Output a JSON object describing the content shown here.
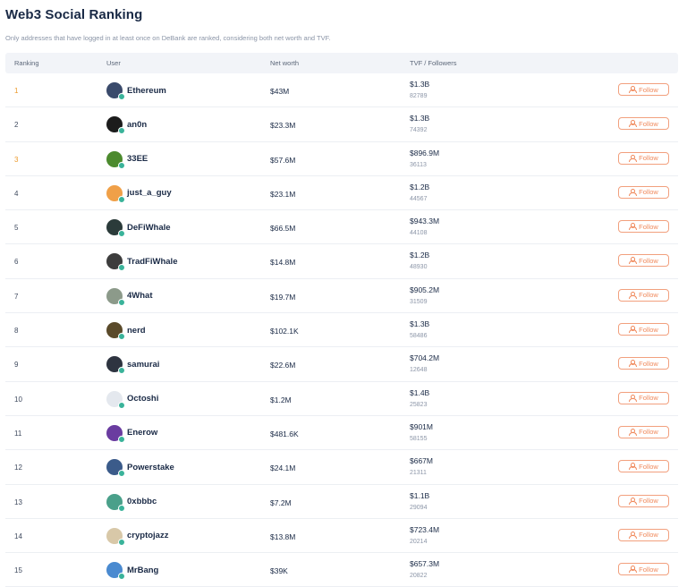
{
  "header": {
    "title": "Web3 Social Ranking",
    "subtitle": "Only addresses that have logged in at least once on DeBank are ranked, considering both net worth and TVF."
  },
  "columns": [
    "Ranking",
    "User",
    "Net worth",
    "TVF / Followers"
  ],
  "follow_label": "Follow",
  "colors": {
    "accent": "#f08a5d",
    "top_rank": "#ec9a2c"
  },
  "rows": [
    {
      "rank": "1",
      "user": "Ethereum",
      "net_worth": "$43M",
      "tvf": "$1.3B",
      "followers": "82789",
      "avatar_color": "#3a4a6b"
    },
    {
      "rank": "2",
      "user": "an0n",
      "net_worth": "$23.3M",
      "tvf": "$1.3B",
      "followers": "74392",
      "avatar_color": "#1c1c1c"
    },
    {
      "rank": "3",
      "user": "33EE",
      "net_worth": "$57.6M",
      "tvf": "$896.9M",
      "followers": "36113",
      "avatar_color": "#4c8a2e"
    },
    {
      "rank": "4",
      "user": "just_a_guy",
      "net_worth": "$23.1M",
      "tvf": "$1.2B",
      "followers": "44567",
      "avatar_color": "#f0a048"
    },
    {
      "rank": "5",
      "user": "DeFiWhale",
      "net_worth": "$66.5M",
      "tvf": "$943.3M",
      "followers": "44108",
      "avatar_color": "#2b3b3a"
    },
    {
      "rank": "6",
      "user": "TradFiWhale",
      "net_worth": "$14.8M",
      "tvf": "$1.2B",
      "followers": "48930",
      "avatar_color": "#3d3d3d"
    },
    {
      "rank": "7",
      "user": "4What",
      "net_worth": "$19.7M",
      "tvf": "$905.2M",
      "followers": "31509",
      "avatar_color": "#8c9a8a"
    },
    {
      "rank": "8",
      "user": "nerd",
      "net_worth": "$102.1K",
      "tvf": "$1.3B",
      "followers": "58486",
      "avatar_color": "#5a4a2a"
    },
    {
      "rank": "9",
      "user": "samurai",
      "net_worth": "$22.6M",
      "tvf": "$704.2M",
      "followers": "12648",
      "avatar_color": "#2e3440"
    },
    {
      "rank": "10",
      "user": "Octoshi",
      "net_worth": "$1.2M",
      "tvf": "$1.4B",
      "followers": "25823",
      "avatar_color": "#e4e8ee"
    },
    {
      "rank": "11",
      "user": "Enerow",
      "net_worth": "$481.6K",
      "tvf": "$901M",
      "followers": "58155",
      "avatar_color": "#6a3ca0"
    },
    {
      "rank": "12",
      "user": "Powerstake",
      "net_worth": "$24.1M",
      "tvf": "$667M",
      "followers": "21311",
      "avatar_color": "#3b5b8a"
    },
    {
      "rank": "13",
      "user": "0xbbbc",
      "net_worth": "$7.2M",
      "tvf": "$1.1B",
      "followers": "29094",
      "avatar_color": "#4aa08a"
    },
    {
      "rank": "14",
      "user": "cryptojazz",
      "net_worth": "$13.8M",
      "tvf": "$723.4M",
      "followers": "20214",
      "avatar_color": "#d8c8a8"
    },
    {
      "rank": "15",
      "user": "MrBang",
      "net_worth": "$39K",
      "tvf": "$657.3M",
      "followers": "20822",
      "avatar_color": "#4a8ad0"
    }
  ]
}
